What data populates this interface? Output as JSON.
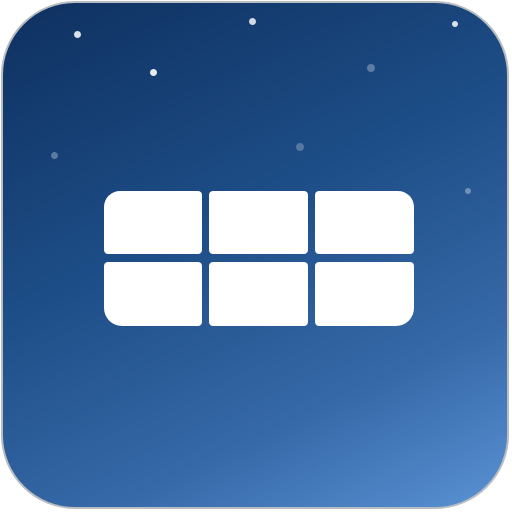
{
  "app_icon": {
    "icon": "grid-icon",
    "background_gradient": [
      "#0e3060",
      "#1d4d86",
      "#3669a8",
      "#5a92d4"
    ],
    "border_color": "#b9bcc1",
    "glyph_color": "#ffffff",
    "grid": {
      "rows": 2,
      "columns": 3
    }
  }
}
